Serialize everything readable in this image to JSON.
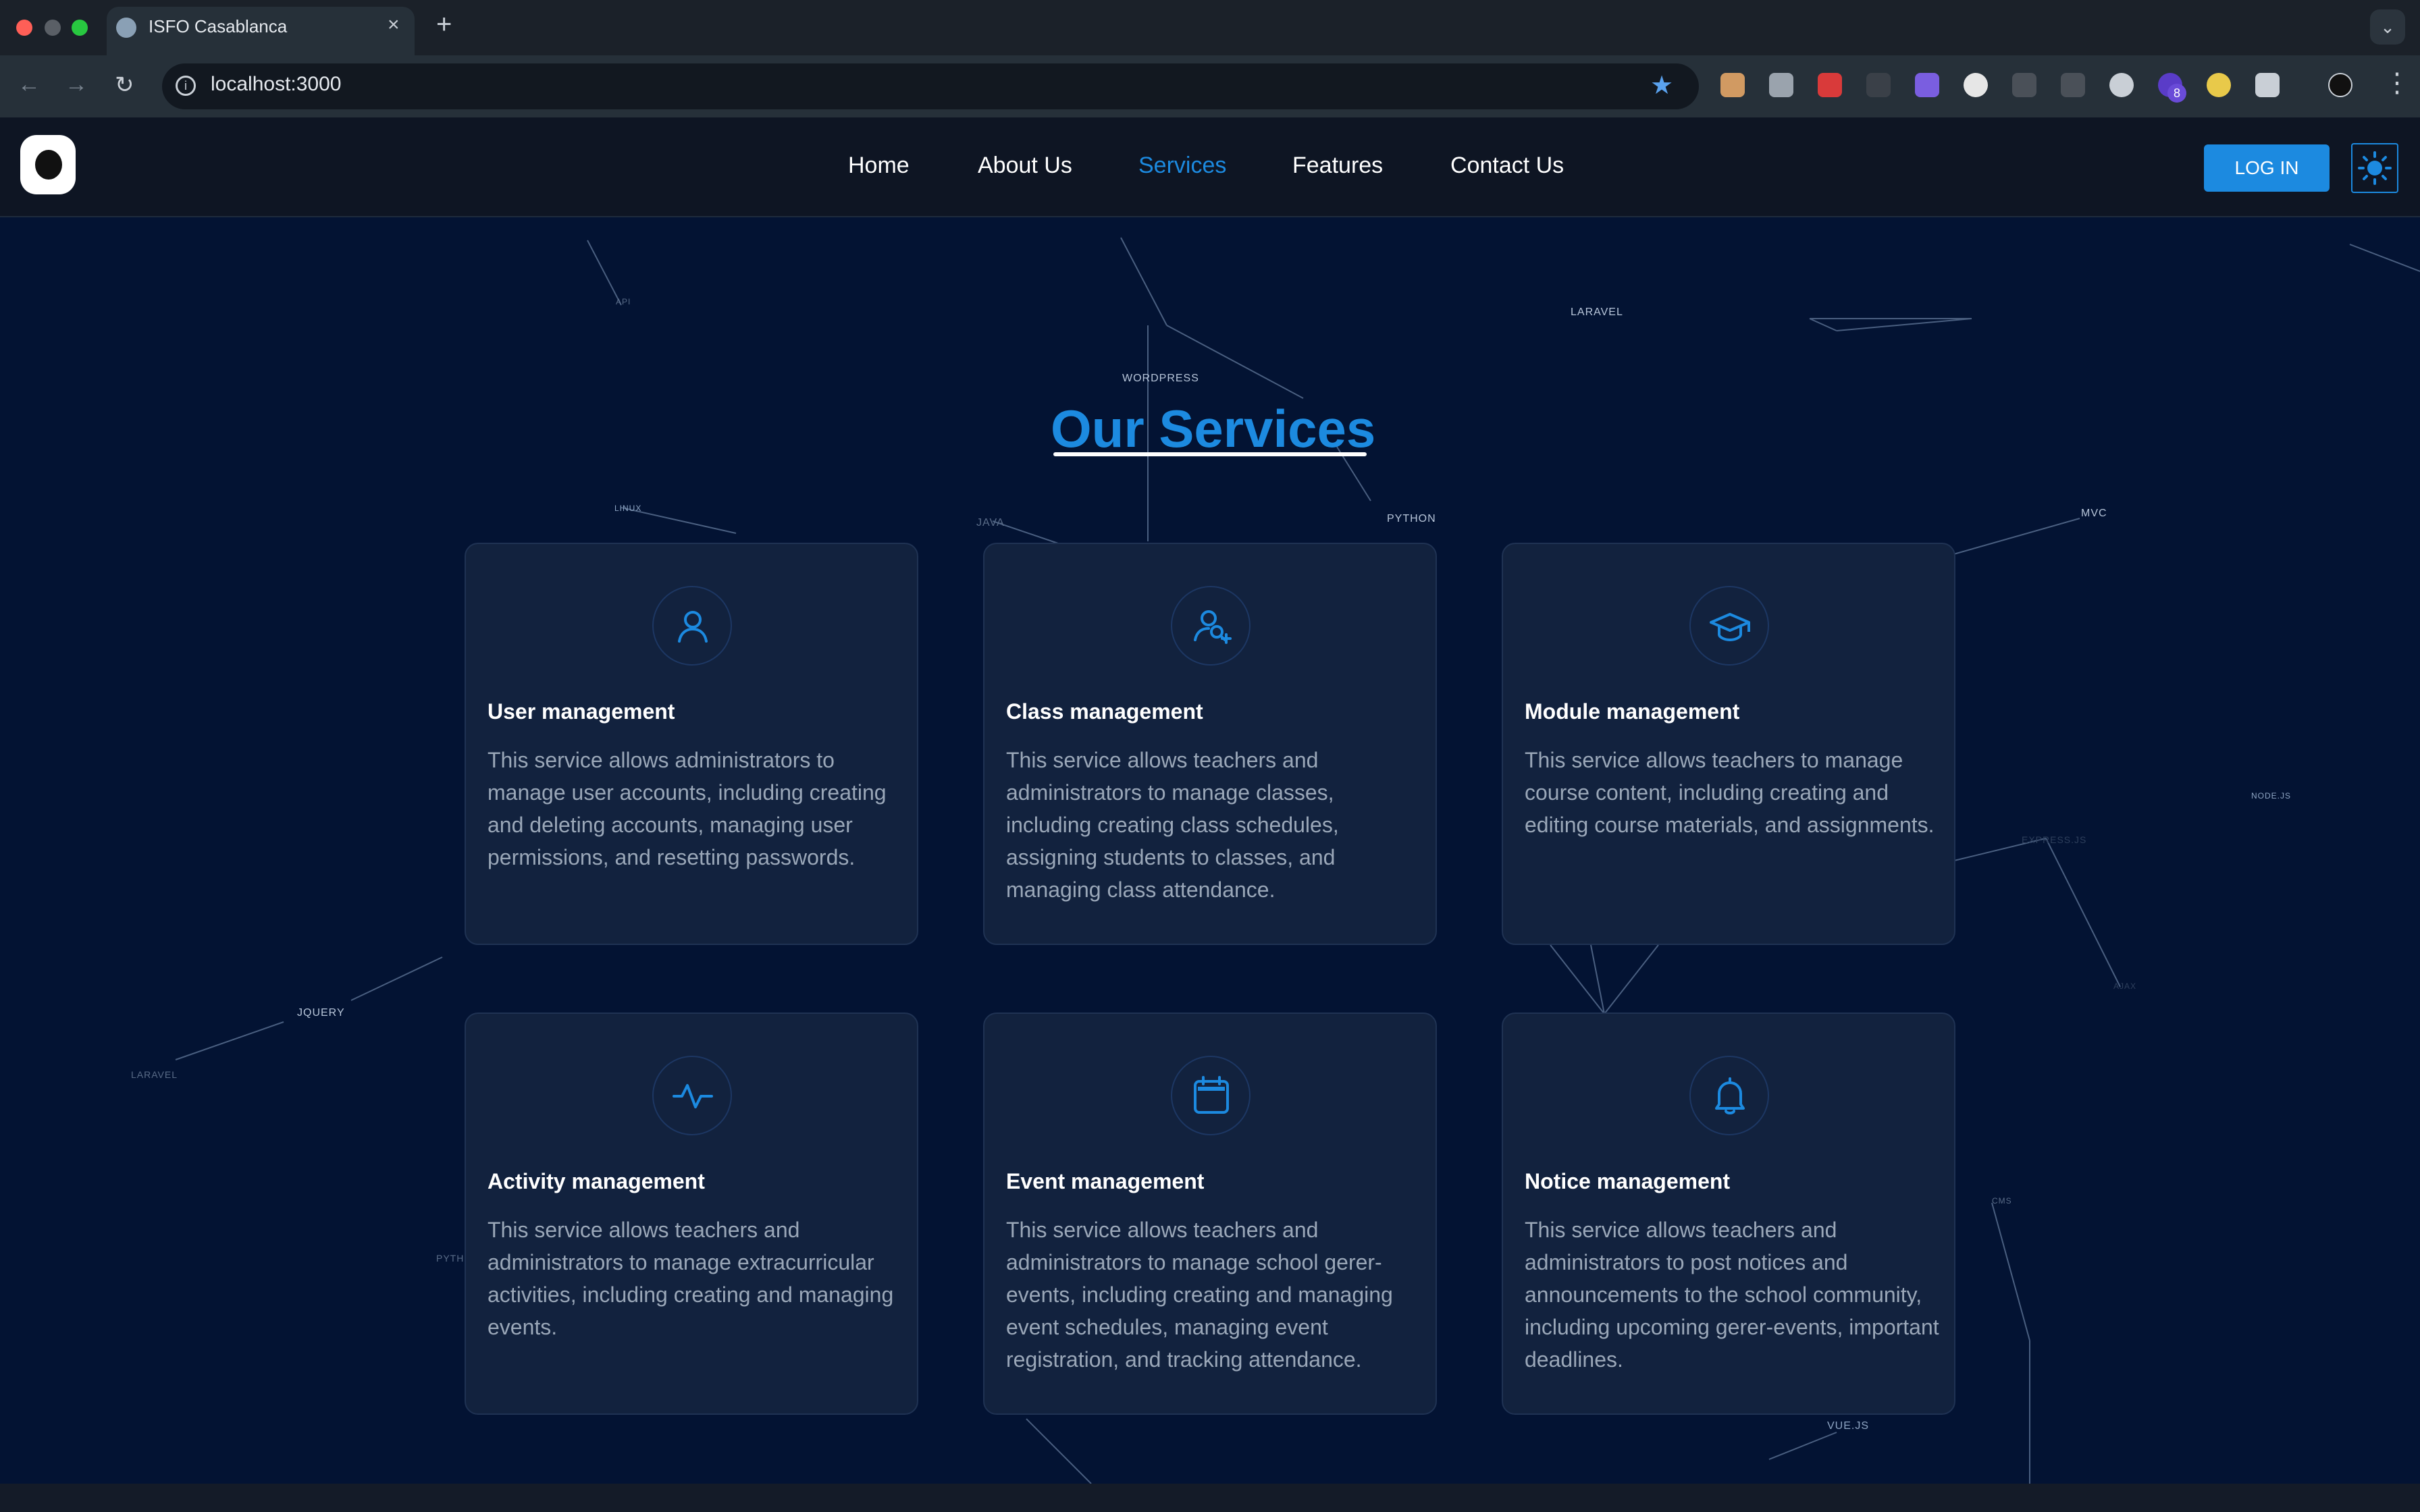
{
  "browser": {
    "tab_title": "ISFO Casablanca",
    "url": "localhost:3000",
    "extension_badge": "8"
  },
  "site": {
    "nav": [
      "Home",
      "About Us",
      "Services",
      "Features",
      "Contact Us"
    ],
    "active_nav": "Services",
    "login_label": "LOG IN",
    "accent_color": "#1c8ae0"
  },
  "background_words": [
    "LARAVEL",
    "WORDPRESS",
    "PYTHON",
    "LINUX",
    "JAVA",
    "MVC",
    "NODE.JS",
    "JQUERY",
    "LARAVEL",
    "CMS",
    "VUE.JS",
    "API",
    "PYTHON",
    "EXPRESS.JS",
    "AJAX"
  ],
  "section": {
    "title": "Our Services"
  },
  "services": [
    {
      "title": "User management",
      "icon": "user-icon",
      "desc": "This service allows administrators to manage user accounts, including creating and deleting accounts, managing user permissions, and resetting passwords."
    },
    {
      "title": "Class management",
      "icon": "user-add-icon",
      "desc": "This service allows teachers and administrators to manage classes, including creating class schedules, assigning students to classes, and managing class attendance."
    },
    {
      "title": "Module management",
      "icon": "graduation-cap-icon",
      "desc": "This service allows teachers to manage course content, including creating and editing course materials, and assignments."
    },
    {
      "title": "Activity management",
      "icon": "activity-icon",
      "desc": "This service allows teachers and administrators to manage extracurricular activities, including creating and managing events."
    },
    {
      "title": "Event management",
      "icon": "calendar-icon",
      "desc": "This service allows teachers and administrators to manage school gerer-events, including creating and managing event schedules, managing event registration, and tracking attendance."
    },
    {
      "title": "Notice management",
      "icon": "bell-icon",
      "desc": "This service allows teachers and administrators to post notices and announcements to the school community, including upcoming gerer-events, important deadlines."
    }
  ]
}
